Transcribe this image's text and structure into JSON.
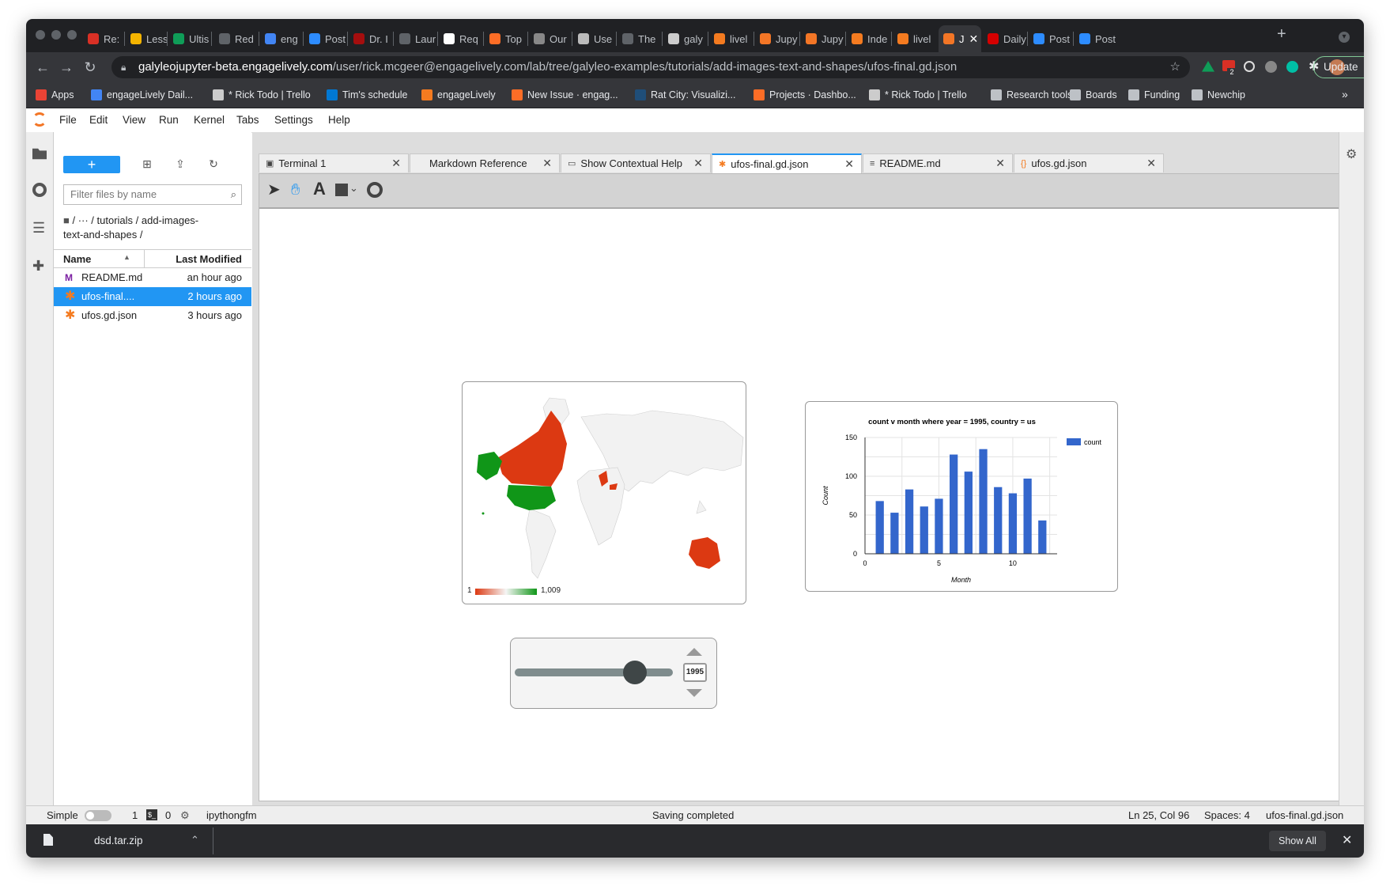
{
  "browser": {
    "tabs": [
      {
        "label": "Re:",
        "color": "#d93025"
      },
      {
        "label": "Less",
        "color": "#f4b400"
      },
      {
        "label": "Ultis",
        "color": "#0f9d58"
      },
      {
        "label": "Red",
        "color": "#5f6368"
      },
      {
        "label": "eng",
        "color": "#4285f4"
      },
      {
        "label": "Post",
        "color": "#2d8cff"
      },
      {
        "label": "Dr. I",
        "color": "#a50e0e"
      },
      {
        "label": "Laur",
        "color": "#5f6368"
      },
      {
        "label": "Req",
        "color": "#ffffff"
      },
      {
        "label": "Top",
        "color": "#fc6d26"
      },
      {
        "label": "Our",
        "color": "#888888"
      },
      {
        "label": "Use",
        "color": "#bbbbbb"
      },
      {
        "label": "The",
        "color": "#5f6368"
      },
      {
        "label": "galy",
        "color": "#cccccc"
      },
      {
        "label": "livel",
        "color": "#f47b20"
      },
      {
        "label": "Jupy",
        "color": "#f37626"
      },
      {
        "label": "Jupy",
        "color": "#f37626"
      },
      {
        "label": "Inde",
        "color": "#f47b20"
      },
      {
        "label": "livel",
        "color": "#f47b20"
      },
      {
        "label": "J",
        "color": "#f37626"
      },
      {
        "label": "Daily",
        "color": "#d50000"
      },
      {
        "label": "Post",
        "color": "#2d8cff"
      },
      {
        "label": "Post",
        "color": "#2d8cff"
      }
    ],
    "new_tab": "+",
    "url_host": "galyleojupyter-beta.engagelively.com",
    "url_path": "/user/rick.mcgeer@engagelively.com/lab/tree/galyleo-examples/tutorials/add-images-text-and-shapes/ufos-final.gd.json",
    "update_label": "Update",
    "extension_badge": "2",
    "bookmarks": [
      {
        "label": "Apps",
        "color": "#ea4335"
      },
      {
        "label": "engageLively Dail...",
        "color": "#4285f4"
      },
      {
        "label": "* Rick Todo | Trello",
        "color": "#cccccc"
      },
      {
        "label": "Tim's schedule",
        "color": "#0078d4"
      },
      {
        "label": "engageLively",
        "color": "#f47b20"
      },
      {
        "label": "New Issue · engag...",
        "color": "#fc6d26"
      },
      {
        "label": "Rat City: Visualizi...",
        "color": "#1f4e79"
      },
      {
        "label": "Projects · Dashbo...",
        "color": "#fc6d26"
      },
      {
        "label": "* Rick Todo | Trello",
        "color": "#cccccc"
      },
      {
        "label": "Research tools",
        "color": "#bdc1c6"
      },
      {
        "label": "Boards",
        "color": "#bdc1c6"
      },
      {
        "label": "Funding",
        "color": "#bdc1c6"
      },
      {
        "label": "Newchip",
        "color": "#bdc1c6"
      }
    ],
    "bookmarks_more": "»"
  },
  "menu": [
    "File",
    "Edit",
    "View",
    "Run",
    "Kernel",
    "Tabs",
    "Settings",
    "Help"
  ],
  "filebrowser": {
    "new_label": "+",
    "filter_placeholder": "Filter files by name",
    "breadcrumb_1": "/ ··· / tutorials / add-images-",
    "breadcrumb_2": "text-and-shapes /",
    "col_name": "Name",
    "col_modified": "Last Modified",
    "files": [
      {
        "name": "README.md",
        "modified": "an hour ago",
        "selected": false
      },
      {
        "name": "ufos-final....",
        "modified": "2 hours ago",
        "selected": true
      },
      {
        "name": "ufos.gd.json",
        "modified": "3 hours ago",
        "selected": false
      }
    ]
  },
  "doc_tabs": [
    {
      "label": "Terminal 1",
      "icon": "terminal-icon",
      "active": false
    },
    {
      "label": "Markdown Reference",
      "icon": "",
      "active": false
    },
    {
      "label": "Show Contextual Help",
      "icon": "help-icon",
      "active": false
    },
    {
      "label": "ufos-final.gd.json",
      "icon": "galyleo-icon",
      "active": true
    },
    {
      "label": "README.md",
      "icon": "text-icon",
      "active": false
    },
    {
      "label": "ufos.gd.json",
      "icon": "json-icon",
      "active": false
    }
  ],
  "map": {
    "legend_min": "1",
    "legend_max": "1,009",
    "low_color": "#dc3912",
    "high_color": "#109618"
  },
  "chart_data": {
    "type": "bar",
    "title": "count v month where year = 1995, country = us",
    "xlabel": "Month",
    "ylabel": "Count",
    "legend": [
      "count"
    ],
    "legend_position": "top-right",
    "x": [
      1,
      2,
      3,
      4,
      5,
      6,
      7,
      8,
      9,
      10,
      11,
      12
    ],
    "series": [
      {
        "name": "count",
        "values": [
          68,
          53,
          83,
          61,
          71,
          128,
          106,
          135,
          86,
          78,
          97,
          43
        ]
      }
    ],
    "xlim": [
      0,
      13
    ],
    "ylim": [
      0,
      150
    ],
    "xticks": [
      "0",
      "5",
      "10"
    ],
    "yticks": [
      "0",
      "50",
      "100",
      "150"
    ],
    "grid": true,
    "bar_color": "#3366cc"
  },
  "slider": {
    "value": "1995",
    "position": 0.76
  },
  "status": {
    "mode": "Simple",
    "kernels": "1",
    "terminals": "0",
    "kernel_name": "ipythongfm",
    "message": "Saving completed",
    "cursor": "Ln 25, Col 96",
    "spaces": "Spaces: 4",
    "file": "ufos-final.gd.json"
  },
  "downloads": {
    "file": "dsd.tar.zip",
    "show_all": "Show All"
  }
}
